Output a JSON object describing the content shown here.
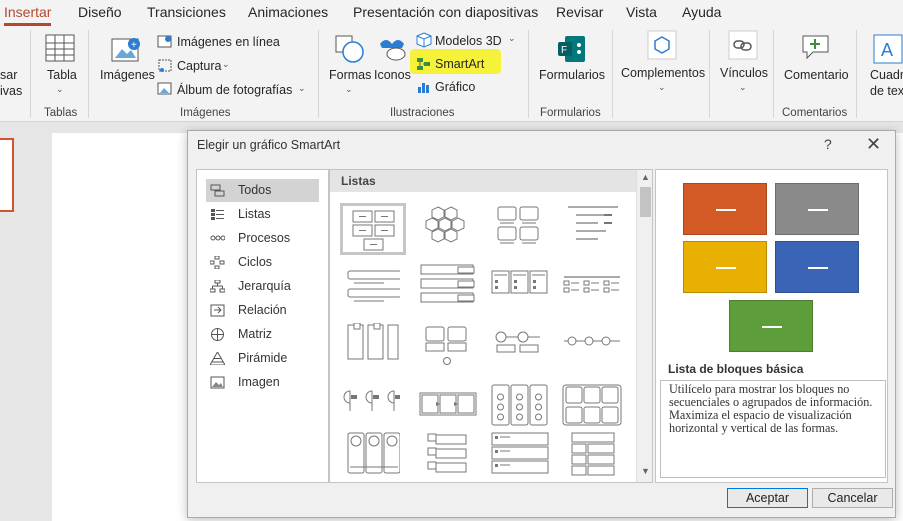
{
  "tabs": [
    "Insertar",
    "Diseño",
    "Transiciones",
    "Animaciones",
    "Presentación con diapositivas",
    "Revisar",
    "Vista",
    "Ayuda"
  ],
  "ribbon": {
    "partial_left": [
      "sar",
      "ivas"
    ],
    "tabla": "Tabla",
    "imagenes": "Imágenes",
    "imagenes_en_linea": "Imágenes en línea",
    "captura": "Captura",
    "album": "Álbum de fotografías",
    "formas": "Formas",
    "iconos": "Iconos",
    "modelos3d": "Modelos 3D",
    "smartart": "SmartArt",
    "grafico": "Gráfico",
    "formularios": "Formularios",
    "complementos": "Complementos",
    "vinculos": "Vínculos",
    "comentario": "Comentario",
    "cuadro_texto": [
      "Cuadr",
      "de tex"
    ],
    "groups": {
      "tablas": "Tablas",
      "imagenes": "Imágenes",
      "ilustraciones": "Ilustraciones",
      "formularios": "Formularios",
      "comentarios": "Comentarios"
    },
    "highlight_color": "#f6f23a"
  },
  "dialog": {
    "title": "Elegir un gráfico SmartArt",
    "help": "?",
    "close": "✕",
    "categories": [
      "Todos",
      "Listas",
      "Procesos",
      "Ciclos",
      "Jerarquía",
      "Relación",
      "Matriz",
      "Pirámide",
      "Imagen"
    ],
    "selected_category": "Todos",
    "gallery_header": "Listas",
    "preview_title": "Lista de bloques básica",
    "preview_description": "Utilícelo para mostrar los bloques no secuenciales o agrupados de información. Maximiza el espacio de visualización horizontal y vertical de las formas.",
    "preview_colors": [
      "#d35a24",
      "#8a8a8a",
      "#e8b000",
      "#3a64b5",
      "#5e9e3a"
    ],
    "accept": "Aceptar",
    "cancel": "Cancelar"
  }
}
